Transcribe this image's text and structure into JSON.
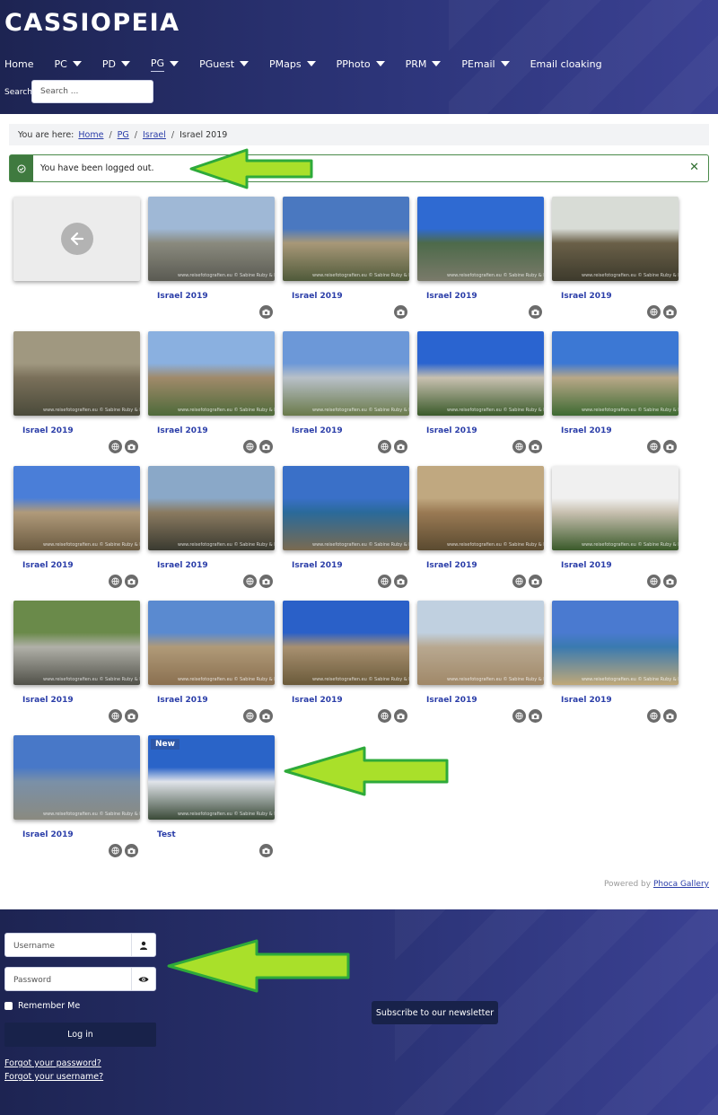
{
  "site": {
    "brand": "CASSIOPEIA"
  },
  "nav": {
    "items": [
      {
        "label": "Home",
        "dropdown": false,
        "active": false
      },
      {
        "label": "PC",
        "dropdown": true,
        "active": false
      },
      {
        "label": "PD",
        "dropdown": true,
        "active": false
      },
      {
        "label": "PG",
        "dropdown": true,
        "active": true
      },
      {
        "label": "PGuest",
        "dropdown": true,
        "active": false
      },
      {
        "label": "PMaps",
        "dropdown": true,
        "active": false
      },
      {
        "label": "PPhoto",
        "dropdown": true,
        "active": false
      },
      {
        "label": "PRM",
        "dropdown": true,
        "active": false
      },
      {
        "label": "PEmail",
        "dropdown": true,
        "active": false
      },
      {
        "label": "Email cloaking",
        "dropdown": false,
        "active": false
      }
    ]
  },
  "search": {
    "label": "Search",
    "placeholder": "Search ..."
  },
  "breadcrumb": {
    "prefix": "You are here:",
    "links": [
      "Home",
      "PG",
      "Israel"
    ],
    "current": "Israel 2019"
  },
  "alert": {
    "message": "You have been logged out.",
    "close": "✕"
  },
  "gallery": {
    "watermark": "www.reisefotografien.eu © Sabine Ruby & Renee Matthias",
    "new_badge": "New",
    "items": [
      {
        "caption": "Israel 2019",
        "geo": false,
        "colors": [
          "#9fb8d6",
          "#8a8a7e",
          "#5a5a52"
        ]
      },
      {
        "caption": "Israel 2019",
        "geo": false,
        "colors": [
          "#4a78c0",
          "#a89878",
          "#4f5a3a"
        ]
      },
      {
        "caption": "Israel 2019",
        "geo": false,
        "colors": [
          "#2f6ad2",
          "#4d6a4a",
          "#7a7a6a"
        ]
      },
      {
        "caption": "Israel 2019",
        "geo": true,
        "colors": [
          "#d8dcd6",
          "#6a6048",
          "#3d3a2c"
        ]
      },
      {
        "caption": "Israel 2019",
        "geo": true,
        "colors": [
          "#a09880",
          "#7a705a",
          "#4a4a3a"
        ]
      },
      {
        "caption": "Israel 2019",
        "geo": true,
        "colors": [
          "#8ab0e0",
          "#a08a6a",
          "#4e6a3a"
        ]
      },
      {
        "caption": "Israel 2019",
        "geo": true,
        "colors": [
          "#6c98d8",
          "#b8c0c8",
          "#6a7a4a"
        ]
      },
      {
        "caption": "Israel 2019",
        "geo": true,
        "colors": [
          "#2a64d0",
          "#c8c0b0",
          "#3a5a2a"
        ]
      },
      {
        "caption": "Israel 2019",
        "geo": true,
        "colors": [
          "#3c78d4",
          "#b8a888",
          "#3e6a32"
        ]
      },
      {
        "caption": "Israel 2019",
        "geo": true,
        "colors": [
          "#4a7ed8",
          "#b09a7a",
          "#6a5a40"
        ]
      },
      {
        "caption": "Israel 2019",
        "geo": true,
        "colors": [
          "#8aa8c8",
          "#8a7a60",
          "#3a3a30"
        ]
      },
      {
        "caption": "Israel 2019",
        "geo": true,
        "colors": [
          "#3a70c8",
          "#2a6a9a",
          "#7a6a50"
        ]
      },
      {
        "caption": "Israel 2019",
        "geo": true,
        "colors": [
          "#c0a880",
          "#9a7a54",
          "#5a4a30"
        ]
      },
      {
        "caption": "Israel 2019",
        "geo": true,
        "colors": [
          "#f0f0f0",
          "#c8c0b0",
          "#3a5a2a"
        ]
      },
      {
        "caption": "Israel 2019",
        "geo": true,
        "colors": [
          "#6a8a4a",
          "#b0b0a8",
          "#505048"
        ]
      },
      {
        "caption": "Israel 2019",
        "geo": true,
        "colors": [
          "#5a8ad0",
          "#b09a78",
          "#8a7050"
        ]
      },
      {
        "caption": "Israel 2019",
        "geo": true,
        "colors": [
          "#2a60c8",
          "#a89070",
          "#6a5a3a"
        ]
      },
      {
        "caption": "Israel 2019",
        "geo": true,
        "colors": [
          "#c0d0e0",
          "#b8a890",
          "#a08868"
        ]
      },
      {
        "caption": "Israel 2019",
        "geo": true,
        "colors": [
          "#4a7ad0",
          "#3a7ab0",
          "#c0a878"
        ]
      },
      {
        "caption": "Israel 2019",
        "geo": true,
        "colors": [
          "#4878c8",
          "#7a90a8",
          "#8a8a80"
        ]
      },
      {
        "caption": "Test",
        "geo": false,
        "new": true,
        "colors": [
          "#2a64c8",
          "#e0e4ea",
          "#3a4a38"
        ]
      }
    ]
  },
  "footer": {
    "powered_by": "Powered by",
    "powered_link": "Phoca Gallery",
    "username_placeholder": "Username",
    "password_placeholder": "Password",
    "remember": "Remember Me",
    "login": "Log in",
    "forgot_password": "Forgot your password?",
    "forgot_username": "Forgot your username?",
    "subscribe": "Subscribe to our newsletter"
  },
  "colors": {
    "header_bg": "#2d357a",
    "link": "#2a3da8",
    "success": "#3f7a3f",
    "annotation_arrow": "#a9e02a"
  }
}
